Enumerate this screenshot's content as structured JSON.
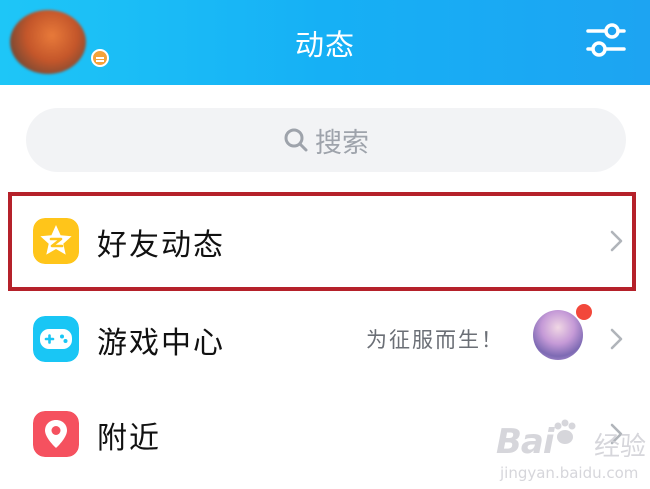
{
  "header": {
    "title": "动态"
  },
  "search": {
    "placeholder": "搜索"
  },
  "menu": [
    {
      "label": "好友动态",
      "icon": "star-friends-icon"
    },
    {
      "label": "游戏中心",
      "icon": "gamepad-icon",
      "promo": "为征服而生！",
      "has_notification_dot": true
    },
    {
      "label": "附近",
      "icon": "location-pin-icon"
    }
  ],
  "watermark": {
    "brand": "Bai",
    "brand_cn": "经验",
    "url": "jingyan.baidu.com"
  },
  "colors": {
    "header_gradient": [
      "#1ec6f7",
      "#1da4f2"
    ],
    "highlight_border": "#b5212a",
    "friends_icon_bg": "#ffc51a",
    "game_icon_bg": "#19c6f5",
    "nearby_icon_bg": "#f5515f",
    "notification_dot": "#f2483b"
  }
}
